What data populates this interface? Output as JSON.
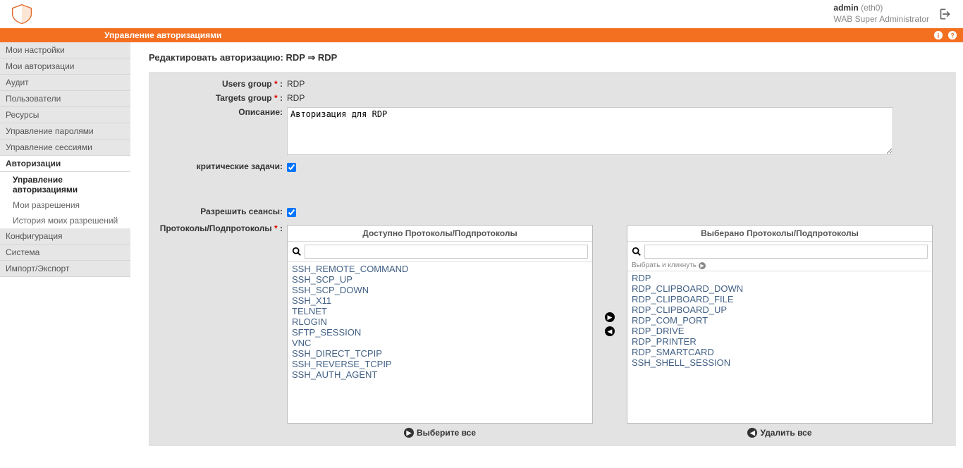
{
  "header": {
    "user_name": "admin",
    "user_iface": "(eth0)",
    "user_role": "WAB Super Administrator"
  },
  "orange": {
    "title": "Управление авторизациями"
  },
  "sidebar": {
    "items": [
      {
        "label": "Мои настройки"
      },
      {
        "label": "Мои авторизации"
      },
      {
        "label": "Аудит"
      },
      {
        "label": "Пользователи"
      },
      {
        "label": "Ресурсы"
      },
      {
        "label": "Управление паролями"
      },
      {
        "label": "Управление сессиями"
      },
      {
        "label": "Авторизации"
      },
      {
        "label": "Конфигурация"
      },
      {
        "label": "Система"
      },
      {
        "label": "Импорт/Экспорт"
      }
    ],
    "sub": [
      {
        "label": "Управление авторизациями"
      },
      {
        "label": "Мои разрешения"
      },
      {
        "label": "История моих разрешений"
      }
    ]
  },
  "page": {
    "title": "Редактировать авторизацию: RDP ⇒ RDP"
  },
  "form": {
    "users_group_label": "Users group",
    "users_group_value": "RDP",
    "targets_group_label": "Targets group",
    "targets_group_value": "RDP",
    "description_label": "Описание:",
    "description_value": "Авторизация для RDP",
    "critical_label": "критические задачи:",
    "allow_sessions_label": "Разрешить сеансы:",
    "protocols_label": "Протоколы/Подпротоколы",
    "colon": " :",
    "asterisk": " *"
  },
  "transfer": {
    "left_title": "Доступно Протоколы/Подпротоколы",
    "right_title": "Выберано Протоколы/Подпротоколы",
    "hint": "Выбрать и кликнуть",
    "left_items": [
      "SSH_REMOTE_COMMAND",
      "SSH_SCP_UP",
      "SSH_SCP_DOWN",
      "SSH_X11",
      "TELNET",
      "RLOGIN",
      "SFTP_SESSION",
      "VNC",
      "SSH_DIRECT_TCPIP",
      "SSH_REVERSE_TCPIP",
      "SSH_AUTH_AGENT"
    ],
    "right_items": [
      "RDP",
      "RDP_CLIPBOARD_DOWN",
      "RDP_CLIPBOARD_FILE",
      "RDP_CLIPBOARD_UP",
      "RDP_COM_PORT",
      "RDP_DRIVE",
      "RDP_PRINTER",
      "RDP_SMARTCARD",
      "SSH_SHELL_SESSION"
    ],
    "select_all": "Выберите все",
    "remove_all": "Удалить все"
  }
}
